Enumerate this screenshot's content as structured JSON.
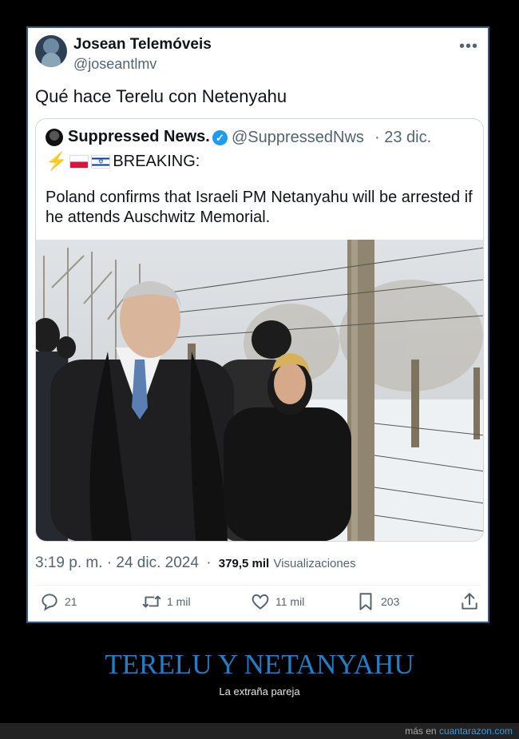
{
  "tweet": {
    "display_name": "Josean Telemóveis",
    "handle": "@joseantlmv",
    "text": "Qué hace Terelu con Netenyahu",
    "timestamp": "3:19 p. m. · 24 dic. 2024",
    "views_count": "379,5 mil",
    "views_label": "Visualizaciones",
    "more_icon": "more-dots-icon"
  },
  "quote": {
    "display_name": "Suppressed News.",
    "handle": "@SuppressedNws",
    "date": "· 23 dic.",
    "breaking_label": "BREAKING:",
    "body": "Poland confirms that Israeli PM Netanyahu will be arrested if he attends Auschwitz Memorial.",
    "photo_alt": ""
  },
  "actions": {
    "replies": "21",
    "retweets": "1 mil",
    "likes": "11 mil",
    "bookmarks": "203"
  },
  "footer": {
    "title": "TERELU Y NETANYAHU",
    "subtitle": "La extraña pareja",
    "credit_prefix": "más en",
    "credit_site": "cuantarazon.com"
  },
  "colors": {
    "accent": "#1d9bf0",
    "footer_title": "#1f7fc8",
    "card_border": "#2e5c8a"
  }
}
